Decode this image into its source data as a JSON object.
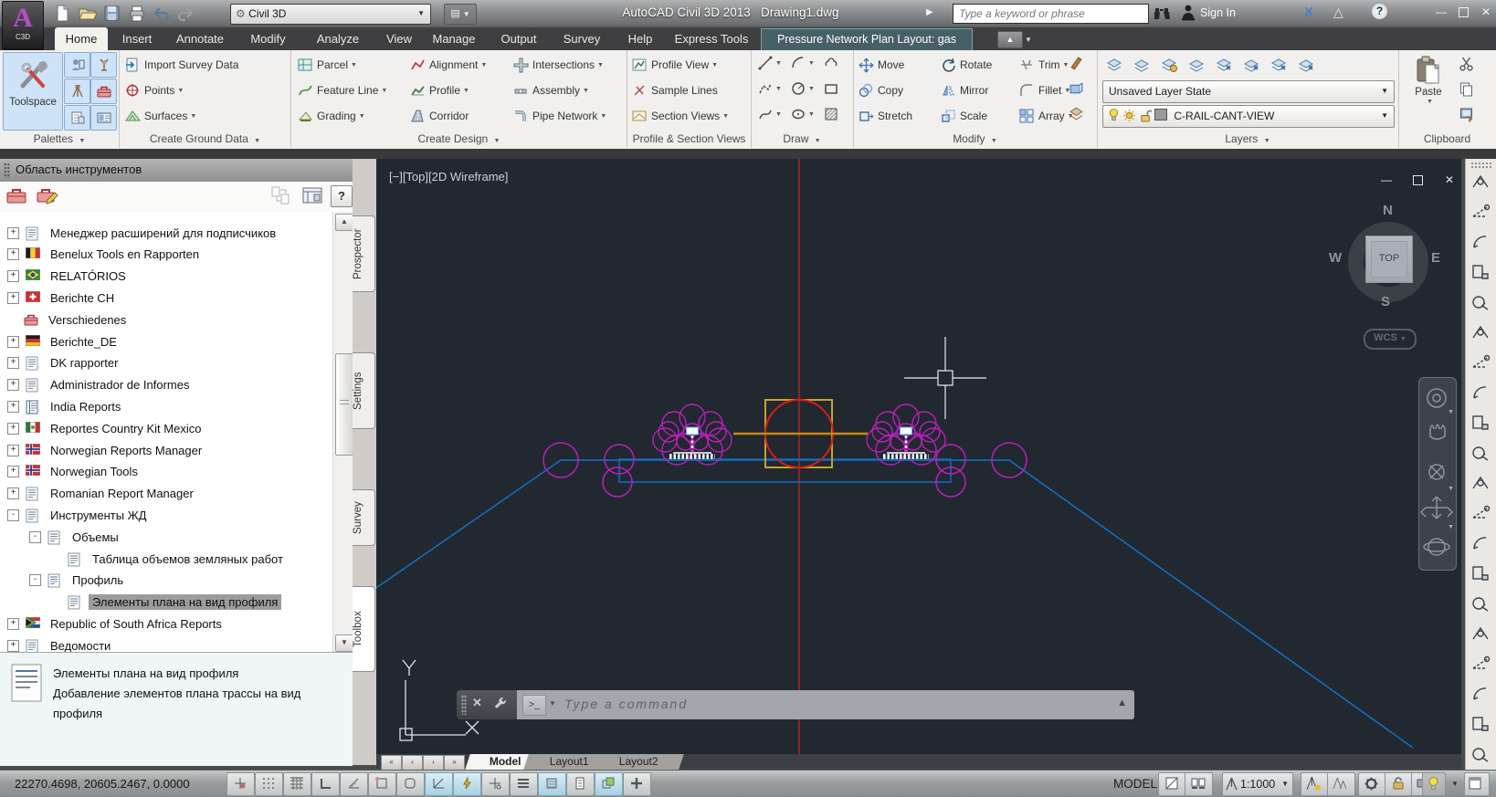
{
  "titlebar": {
    "logo": "A",
    "logo_sub": "C3D",
    "workspace": "Civil 3D",
    "app_title": "AutoCAD Civil 3D 2013",
    "doc_title": "Drawing1.dwg",
    "search_placeholder": "Type a keyword or phrase",
    "signin_label": "Sign In"
  },
  "ribbon": {
    "tabs": [
      "Home",
      "Insert",
      "Annotate",
      "Modify",
      "Analyze",
      "View",
      "Manage",
      "Output",
      "Survey",
      "Help",
      "Express Tools"
    ],
    "active_tab": "Home",
    "contextual_tab": "Pressure Network Plan Layout: gas",
    "panels": {
      "palettes": {
        "label": "Palettes",
        "toolspace": "Toolspace"
      },
      "create_ground_data": {
        "label": "Create Ground Data",
        "items": [
          {
            "label": "Import Survey Data",
            "arrow": false,
            "icon": "import-survey"
          },
          {
            "label": "Points",
            "arrow": true,
            "icon": "points"
          },
          {
            "label": "Surfaces",
            "arrow": true,
            "icon": "surfaces"
          }
        ]
      },
      "create_design": {
        "label": "Create Design",
        "cols": [
          [
            {
              "label": "Parcel",
              "arrow": true,
              "icon": "parcel"
            },
            {
              "label": "Feature Line",
              "arrow": true,
              "icon": "feature-line"
            },
            {
              "label": "Grading",
              "arrow": true,
              "icon": "grading"
            }
          ],
          [
            {
              "label": "Alignment",
              "arrow": true,
              "icon": "alignment"
            },
            {
              "label": "Profile",
              "arrow": true,
              "icon": "profile"
            },
            {
              "label": "Corridor",
              "arrow": false,
              "icon": "corridor"
            }
          ],
          [
            {
              "label": "Intersections",
              "arrow": true,
              "icon": "intersections"
            },
            {
              "label": "Assembly",
              "arrow": true,
              "icon": "assembly"
            },
            {
              "label": "Pipe Network",
              "arrow": true,
              "icon": "pipe-network"
            }
          ]
        ]
      },
      "profile_section_views": {
        "label": "Profile & Section Views",
        "items": [
          {
            "label": "Profile View",
            "arrow": true,
            "icon": "profile-view"
          },
          {
            "label": "Sample Lines",
            "arrow": false,
            "icon": "sample-lines"
          },
          {
            "label": "Section Views",
            "arrow": true,
            "icon": "section-views"
          }
        ]
      },
      "draw": {
        "label": "Draw"
      },
      "modify": {
        "label": "Modify",
        "cols": [
          [
            {
              "label": "Move",
              "icon": "move"
            },
            {
              "label": "Copy",
              "icon": "copy"
            },
            {
              "label": "Stretch",
              "icon": "stretch"
            }
          ],
          [
            {
              "label": "Rotate",
              "icon": "rotate"
            },
            {
              "label": "Mirror",
              "icon": "mirror"
            },
            {
              "label": "Scale",
              "icon": "scale"
            }
          ],
          [
            {
              "label": "Trim",
              "arrow": true,
              "icon": "trim"
            },
            {
              "label": "Fillet",
              "arrow": true,
              "icon": "fillet"
            },
            {
              "label": "Array",
              "arrow": true,
              "icon": "array"
            }
          ]
        ]
      },
      "layers": {
        "label": "Layers",
        "layer_state": "Unsaved Layer State",
        "current_layer": "C-RAIL-CANT-VIEW"
      },
      "clipboard": {
        "label": "Clipboard",
        "paste": "Paste"
      }
    }
  },
  "toolspace": {
    "title": "Область инструментов",
    "tabs": [
      {
        "label": "Prospector",
        "active": false
      },
      {
        "label": "Settings",
        "active": false
      },
      {
        "label": "Survey",
        "active": false
      },
      {
        "label": "Toolbox",
        "active": true
      }
    ],
    "tree": [
      {
        "label": "Менеджер расширений для подписчиков",
        "level": 0,
        "expander": "+",
        "icon": "report"
      },
      {
        "label": "Benelux Tools en Rapporten",
        "level": 0,
        "expander": "+",
        "icon": "flag-be"
      },
      {
        "label": "RELATÓRIOS",
        "level": 0,
        "expander": "+",
        "icon": "flag-br"
      },
      {
        "label": "Berichte CH",
        "level": 0,
        "expander": "+",
        "icon": "flag-ch"
      },
      {
        "label": "Verschiedenes",
        "level": 0,
        "expander": "",
        "icon": "toolbox"
      },
      {
        "label": "Berichte_DE",
        "level": 0,
        "expander": "+",
        "icon": "flag-de"
      },
      {
        "label": "DK rapporter",
        "level": 0,
        "expander": "+",
        "icon": "report"
      },
      {
        "label": "Administrador de Informes",
        "level": 0,
        "expander": "+",
        "icon": "report"
      },
      {
        "label": "India Reports",
        "level": 0,
        "expander": "+",
        "icon": "report2"
      },
      {
        "label": "Reportes Country Kit Mexico",
        "level": 0,
        "expander": "+",
        "icon": "flag-mx"
      },
      {
        "label": "Norwegian Reports Manager",
        "level": 0,
        "expander": "+",
        "icon": "flag-no"
      },
      {
        "label": "Norwegian Tools",
        "level": 0,
        "expander": "+",
        "icon": "flag-no"
      },
      {
        "label": "Romanian Report Manager",
        "level": 0,
        "expander": "+",
        "icon": "report"
      },
      {
        "label": "Инструменты ЖД",
        "level": 0,
        "expander": "-",
        "icon": "report"
      },
      {
        "label": "Объемы",
        "level": 1,
        "expander": "-",
        "icon": "report"
      },
      {
        "label": "Таблица объемов земляных работ",
        "level": 2,
        "expander": "",
        "icon": "report"
      },
      {
        "label": "Профиль",
        "level": 1,
        "expander": "-",
        "icon": "report"
      },
      {
        "label": "Элементы плана на вид профиля",
        "level": 2,
        "expander": "",
        "icon": "report",
        "selected": true
      },
      {
        "label": "Republic of South Africa Reports",
        "level": 0,
        "expander": "+",
        "icon": "flag-za"
      },
      {
        "label": "Ведомости",
        "level": 0,
        "expander": "+",
        "icon": "report"
      }
    ],
    "description": {
      "title": "Элементы плана на вид профиля",
      "line1": "Добавление элементов плана трассы на вид",
      "line2": "профиля"
    }
  },
  "canvas": {
    "viewport_label": "[−][Top][2D Wireframe]",
    "viewcube": {
      "n": "N",
      "s": "S",
      "e": "E",
      "w": "W",
      "top": "TOP"
    },
    "wcs_label": "WCS",
    "command_placeholder": "Type a command"
  },
  "model_tabs": {
    "items": [
      "Model",
      "Layout1",
      "Layout2"
    ],
    "active": "Model"
  },
  "statusbar": {
    "coords": "22270.4698, 20605.2467, 0.0000",
    "model_label": "MODEL",
    "annotation_scale": "1:1000"
  },
  "colors": {
    "canvas_bg": "#212830",
    "red_line": "#a82522",
    "red_circle": "#d32113",
    "yellow_box": "#c9a227",
    "orange_line": "#c9881a",
    "blue_line": "#1569b5",
    "magenta": "#bb1fbb",
    "white": "#e8eef2"
  }
}
